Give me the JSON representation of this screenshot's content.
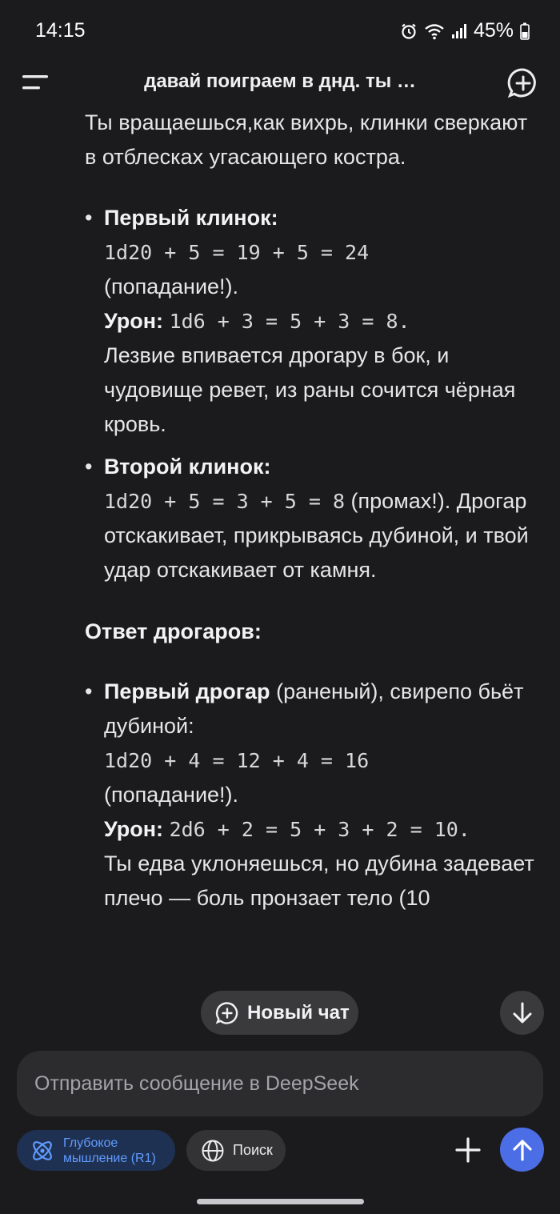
{
  "status_bar": {
    "time": "14:15",
    "battery": "45%",
    "icons": [
      "alarm-icon",
      "wifi-icon",
      "signal-icon",
      "battery-icon"
    ]
  },
  "header": {
    "title": "давай поиграем в днд. ты …",
    "menu_icon": "menu-icon",
    "new_chat_icon": "chat-plus-icon"
  },
  "message": {
    "intro": "Ты вращаешься,как вихрь, клинки сверкают в отблесках угасающего костра.",
    "hit1": {
      "title": "Первый клинок:",
      "roll": "1d20 + 5 = 19 + 5 = 24",
      "roll_result": "(попадание!).",
      "damage_label": "Урон:",
      "damage_roll": "1d6 + 3 = 5 + 3 = 8.",
      "description": "Лезвие впивается дрогару в бок, и чудовище ревет, из раны сочится чёрная кровь."
    },
    "hit2": {
      "title": "Второй клинок:",
      "roll": "1d20 + 5 = 3 + 5 = 8",
      "roll_result": "(промах!).",
      "description": "Дрогар отскакивает, прикрываясь дубиной, и твой удар отскакивает от камня."
    },
    "answer_heading": "Ответ дрогаров:",
    "enemy1": {
      "title": "Первый дрогар",
      "title_suffix": "(раненый), свирепо бьёт дубиной:",
      "roll": "1d20 + 4 = 12 + 4 = 16",
      "roll_result": "(попадание!).",
      "damage_label": "Урон:",
      "damage_roll": "2d6 + 2 = 5 + 3 + 2 = 10.",
      "description": "Ты едва уклоняешься, но дубина задевает плечо — боль пронзает тело (10"
    }
  },
  "floating": {
    "new_chat_label": "Новый чат"
  },
  "input": {
    "placeholder": "Отправить сообщение в DeepSeek",
    "value": ""
  },
  "toolbar": {
    "deepthink_label": "Глубокое\nмышление (R1)",
    "search_label": "Поиск"
  },
  "colors": {
    "background": "#1b1b1d",
    "accent_blue": "#4b6ee6",
    "deepthink_text": "#5f9bff",
    "deepthink_bg": "#1f3153"
  }
}
